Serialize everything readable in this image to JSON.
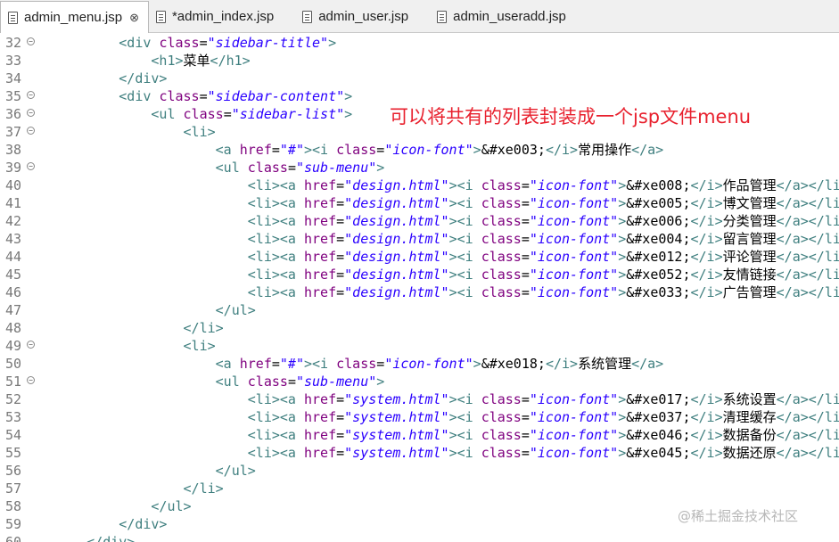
{
  "tabs": [
    {
      "label": "admin_menu.jsp",
      "active": true,
      "close": "⊗"
    },
    {
      "label": "*admin_index.jsp",
      "active": false
    },
    {
      "label": "admin_user.jsp",
      "active": false
    },
    {
      "label": "admin_useradd.jsp",
      "active": false
    }
  ],
  "editor": {
    "lines": [
      {
        "n": "32",
        "fold": true,
        "indent": 8,
        "parts": [
          [
            "tag",
            "<div "
          ],
          [
            "attr",
            "class"
          ],
          [
            "code",
            "="
          ],
          [
            "val",
            "\"sidebar-title\""
          ],
          [
            "tag",
            ">"
          ]
        ]
      },
      {
        "n": "33",
        "fold": false,
        "indent": 12,
        "parts": [
          [
            "tag",
            "<h1>"
          ],
          [
            "txt",
            "菜单"
          ],
          [
            "tag",
            "</h1>"
          ]
        ]
      },
      {
        "n": "34",
        "fold": false,
        "indent": 8,
        "parts": [
          [
            "tag",
            "</div>"
          ]
        ]
      },
      {
        "n": "35",
        "fold": true,
        "indent": 8,
        "parts": [
          [
            "tag",
            "<div "
          ],
          [
            "attr",
            "class"
          ],
          [
            "code",
            "="
          ],
          [
            "val",
            "\"sidebar-content\""
          ],
          [
            "tag",
            ">"
          ]
        ]
      },
      {
        "n": "36",
        "fold": true,
        "indent": 12,
        "parts": [
          [
            "tag",
            "<ul "
          ],
          [
            "attr",
            "class"
          ],
          [
            "code",
            "="
          ],
          [
            "val",
            "\"sidebar-list\""
          ],
          [
            "tag",
            ">"
          ]
        ]
      },
      {
        "n": "37",
        "fold": true,
        "indent": 16,
        "parts": [
          [
            "tag",
            "<li>"
          ]
        ]
      },
      {
        "n": "38",
        "fold": false,
        "indent": 20,
        "parts": [
          [
            "tag",
            "<a "
          ],
          [
            "attr",
            "href"
          ],
          [
            "code",
            "="
          ],
          [
            "val",
            "\"#\""
          ],
          [
            "tag",
            "><i "
          ],
          [
            "attr",
            "class"
          ],
          [
            "code",
            "="
          ],
          [
            "val",
            "\"icon-font\""
          ],
          [
            "tag",
            ">"
          ],
          [
            "txt",
            "&#xe003;"
          ],
          [
            "tag",
            "</i>"
          ],
          [
            "txt",
            "常用操作"
          ],
          [
            "tag",
            "</a>"
          ]
        ]
      },
      {
        "n": "39",
        "fold": true,
        "indent": 20,
        "parts": [
          [
            "tag",
            "<ul "
          ],
          [
            "attr",
            "class"
          ],
          [
            "code",
            "="
          ],
          [
            "val",
            "\"sub-menu\""
          ],
          [
            "tag",
            ">"
          ]
        ]
      },
      {
        "n": "40",
        "fold": false,
        "indent": 24,
        "parts": [
          [
            "tag",
            "<li><a "
          ],
          [
            "attr",
            "href"
          ],
          [
            "code",
            "="
          ],
          [
            "val",
            "\"design.html\""
          ],
          [
            "tag",
            "><i "
          ],
          [
            "attr",
            "class"
          ],
          [
            "code",
            "="
          ],
          [
            "val",
            "\"icon-font\""
          ],
          [
            "tag",
            ">"
          ],
          [
            "txt",
            "&#xe008;"
          ],
          [
            "tag",
            "</i>"
          ],
          [
            "txt",
            "作品管理"
          ],
          [
            "tag",
            "</a></li>"
          ]
        ]
      },
      {
        "n": "41",
        "fold": false,
        "indent": 24,
        "parts": [
          [
            "tag",
            "<li><a "
          ],
          [
            "attr",
            "href"
          ],
          [
            "code",
            "="
          ],
          [
            "val",
            "\"design.html\""
          ],
          [
            "tag",
            "><i "
          ],
          [
            "attr",
            "class"
          ],
          [
            "code",
            "="
          ],
          [
            "val",
            "\"icon-font\""
          ],
          [
            "tag",
            ">"
          ],
          [
            "txt",
            "&#xe005;"
          ],
          [
            "tag",
            "</i>"
          ],
          [
            "txt",
            "博文管理"
          ],
          [
            "tag",
            "</a></li>"
          ]
        ]
      },
      {
        "n": "42",
        "fold": false,
        "indent": 24,
        "parts": [
          [
            "tag",
            "<li><a "
          ],
          [
            "attr",
            "href"
          ],
          [
            "code",
            "="
          ],
          [
            "val",
            "\"design.html\""
          ],
          [
            "tag",
            "><i "
          ],
          [
            "attr",
            "class"
          ],
          [
            "code",
            "="
          ],
          [
            "val",
            "\"icon-font\""
          ],
          [
            "tag",
            ">"
          ],
          [
            "txt",
            "&#xe006;"
          ],
          [
            "tag",
            "</i>"
          ],
          [
            "txt",
            "分类管理"
          ],
          [
            "tag",
            "</a></li>"
          ]
        ]
      },
      {
        "n": "43",
        "fold": false,
        "indent": 24,
        "parts": [
          [
            "tag",
            "<li><a "
          ],
          [
            "attr",
            "href"
          ],
          [
            "code",
            "="
          ],
          [
            "val",
            "\"design.html\""
          ],
          [
            "tag",
            "><i "
          ],
          [
            "attr",
            "class"
          ],
          [
            "code",
            "="
          ],
          [
            "val",
            "\"icon-font\""
          ],
          [
            "tag",
            ">"
          ],
          [
            "txt",
            "&#xe004;"
          ],
          [
            "tag",
            "</i>"
          ],
          [
            "txt",
            "留言管理"
          ],
          [
            "tag",
            "</a></li>"
          ]
        ]
      },
      {
        "n": "44",
        "fold": false,
        "indent": 24,
        "parts": [
          [
            "tag",
            "<li><a "
          ],
          [
            "attr",
            "href"
          ],
          [
            "code",
            "="
          ],
          [
            "val",
            "\"design.html\""
          ],
          [
            "tag",
            "><i "
          ],
          [
            "attr",
            "class"
          ],
          [
            "code",
            "="
          ],
          [
            "val",
            "\"icon-font\""
          ],
          [
            "tag",
            ">"
          ],
          [
            "txt",
            "&#xe012;"
          ],
          [
            "tag",
            "</i>"
          ],
          [
            "txt",
            "评论管理"
          ],
          [
            "tag",
            "</a></li>"
          ]
        ]
      },
      {
        "n": "45",
        "fold": false,
        "indent": 24,
        "parts": [
          [
            "tag",
            "<li><a "
          ],
          [
            "attr",
            "href"
          ],
          [
            "code",
            "="
          ],
          [
            "val",
            "\"design.html\""
          ],
          [
            "tag",
            "><i "
          ],
          [
            "attr",
            "class"
          ],
          [
            "code",
            "="
          ],
          [
            "val",
            "\"icon-font\""
          ],
          [
            "tag",
            ">"
          ],
          [
            "txt",
            "&#xe052;"
          ],
          [
            "tag",
            "</i>"
          ],
          [
            "txt",
            "友情链接"
          ],
          [
            "tag",
            "</a></li>"
          ]
        ]
      },
      {
        "n": "46",
        "fold": false,
        "indent": 24,
        "parts": [
          [
            "tag",
            "<li><a "
          ],
          [
            "attr",
            "href"
          ],
          [
            "code",
            "="
          ],
          [
            "val",
            "\"design.html\""
          ],
          [
            "tag",
            "><i "
          ],
          [
            "attr",
            "class"
          ],
          [
            "code",
            "="
          ],
          [
            "val",
            "\"icon-font\""
          ],
          [
            "tag",
            ">"
          ],
          [
            "txt",
            "&#xe033;"
          ],
          [
            "tag",
            "</i>"
          ],
          [
            "txt",
            "广告管理"
          ],
          [
            "tag",
            "</a></li>"
          ]
        ]
      },
      {
        "n": "47",
        "fold": false,
        "indent": 20,
        "parts": [
          [
            "tag",
            "</ul>"
          ]
        ]
      },
      {
        "n": "48",
        "fold": false,
        "indent": 16,
        "parts": [
          [
            "tag",
            "</li>"
          ]
        ]
      },
      {
        "n": "49",
        "fold": true,
        "indent": 16,
        "parts": [
          [
            "tag",
            "<li>"
          ]
        ]
      },
      {
        "n": "50",
        "fold": false,
        "indent": 20,
        "parts": [
          [
            "tag",
            "<a "
          ],
          [
            "attr",
            "href"
          ],
          [
            "code",
            "="
          ],
          [
            "val",
            "\"#\""
          ],
          [
            "tag",
            "><i "
          ],
          [
            "attr",
            "class"
          ],
          [
            "code",
            "="
          ],
          [
            "val",
            "\"icon-font\""
          ],
          [
            "tag",
            ">"
          ],
          [
            "txt",
            "&#xe018;"
          ],
          [
            "tag",
            "</i>"
          ],
          [
            "txt",
            "系统管理"
          ],
          [
            "tag",
            "</a>"
          ]
        ]
      },
      {
        "n": "51",
        "fold": true,
        "indent": 20,
        "parts": [
          [
            "tag",
            "<ul "
          ],
          [
            "attr",
            "class"
          ],
          [
            "code",
            "="
          ],
          [
            "val",
            "\"sub-menu\""
          ],
          [
            "tag",
            ">"
          ]
        ]
      },
      {
        "n": "52",
        "fold": false,
        "indent": 24,
        "parts": [
          [
            "tag",
            "<li><a "
          ],
          [
            "attr",
            "href"
          ],
          [
            "code",
            "="
          ],
          [
            "val",
            "\"system.html\""
          ],
          [
            "tag",
            "><i "
          ],
          [
            "attr",
            "class"
          ],
          [
            "code",
            "="
          ],
          [
            "val",
            "\"icon-font\""
          ],
          [
            "tag",
            ">"
          ],
          [
            "txt",
            "&#xe017;"
          ],
          [
            "tag",
            "</i>"
          ],
          [
            "txt",
            "系统设置"
          ],
          [
            "tag",
            "</a></li>"
          ]
        ]
      },
      {
        "n": "53",
        "fold": false,
        "indent": 24,
        "parts": [
          [
            "tag",
            "<li><a "
          ],
          [
            "attr",
            "href"
          ],
          [
            "code",
            "="
          ],
          [
            "val",
            "\"system.html\""
          ],
          [
            "tag",
            "><i "
          ],
          [
            "attr",
            "class"
          ],
          [
            "code",
            "="
          ],
          [
            "val",
            "\"icon-font\""
          ],
          [
            "tag",
            ">"
          ],
          [
            "txt",
            "&#xe037;"
          ],
          [
            "tag",
            "</i>"
          ],
          [
            "txt",
            "清理缓存"
          ],
          [
            "tag",
            "</a></li>"
          ]
        ]
      },
      {
        "n": "54",
        "fold": false,
        "indent": 24,
        "parts": [
          [
            "tag",
            "<li><a "
          ],
          [
            "attr",
            "href"
          ],
          [
            "code",
            "="
          ],
          [
            "val",
            "\"system.html\""
          ],
          [
            "tag",
            "><i "
          ],
          [
            "attr",
            "class"
          ],
          [
            "code",
            "="
          ],
          [
            "val",
            "\"icon-font\""
          ],
          [
            "tag",
            ">"
          ],
          [
            "txt",
            "&#xe046;"
          ],
          [
            "tag",
            "</i>"
          ],
          [
            "txt",
            "数据备份"
          ],
          [
            "tag",
            "</a></li>"
          ]
        ]
      },
      {
        "n": "55",
        "fold": false,
        "indent": 24,
        "parts": [
          [
            "tag",
            "<li><a "
          ],
          [
            "attr",
            "href"
          ],
          [
            "code",
            "="
          ],
          [
            "val",
            "\"system.html\""
          ],
          [
            "tag",
            "><i "
          ],
          [
            "attr",
            "class"
          ],
          [
            "code",
            "="
          ],
          [
            "val",
            "\"icon-font\""
          ],
          [
            "tag",
            ">"
          ],
          [
            "txt",
            "&#xe045;"
          ],
          [
            "tag",
            "</i>"
          ],
          [
            "txt",
            "数据还原"
          ],
          [
            "tag",
            "</a></li>"
          ]
        ]
      },
      {
        "n": "56",
        "fold": false,
        "indent": 20,
        "parts": [
          [
            "tag",
            "</ul>"
          ]
        ]
      },
      {
        "n": "57",
        "fold": false,
        "indent": 16,
        "parts": [
          [
            "tag",
            "</li>"
          ]
        ]
      },
      {
        "n": "58",
        "fold": false,
        "indent": 12,
        "parts": [
          [
            "tag",
            "</ul>"
          ]
        ]
      },
      {
        "n": "59",
        "fold": false,
        "indent": 8,
        "parts": [
          [
            "tag",
            "</div>"
          ]
        ]
      },
      {
        "n": "60",
        "fold": false,
        "indent": 4,
        "parts": [
          [
            "tag",
            "</div>"
          ]
        ]
      }
    ]
  },
  "annotation": "可以将共有的列表封装成一个jsp文件menu",
  "watermark": "@稀土掘金技术社区",
  "colors": {
    "tag": "#3f7f7f",
    "attr": "#7f007f",
    "value": "#2a00ff",
    "annotation": "#e8212e"
  }
}
